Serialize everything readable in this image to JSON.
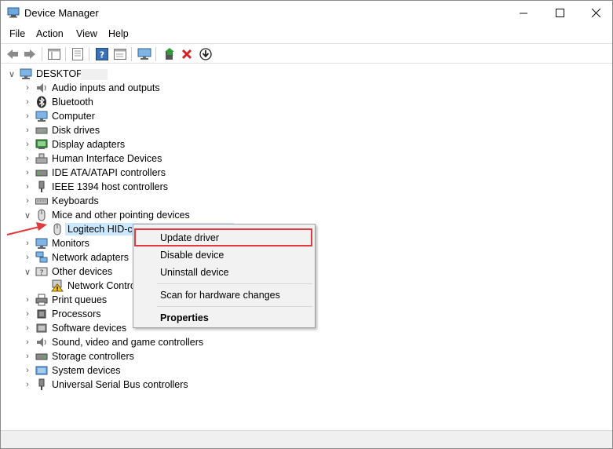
{
  "window": {
    "title": "Device Manager"
  },
  "menu": [
    "File",
    "Action",
    "View",
    "Help"
  ],
  "tree": {
    "root": "DESKTOP",
    "categories": [
      {
        "label": "Audio inputs and outputs",
        "icon": "speaker-icon"
      },
      {
        "label": "Bluetooth",
        "icon": "bluetooth-icon"
      },
      {
        "label": "Computer",
        "icon": "computer-icon"
      },
      {
        "label": "Disk drives",
        "icon": "disk-drive-icon"
      },
      {
        "label": "Display adapters",
        "icon": "display-adapter-icon"
      },
      {
        "label": "Human Interface Devices",
        "icon": "hid-icon"
      },
      {
        "label": "IDE ATA/ATAPI controllers",
        "icon": "ide-controller-icon"
      },
      {
        "label": "IEEE 1394 host controllers",
        "icon": "ieee1394-icon"
      },
      {
        "label": "Keyboards",
        "icon": "keyboard-icon"
      },
      {
        "label": "Mice and other pointing devices",
        "icon": "mouse-icon",
        "expanded": true
      },
      {
        "label": "Monitors",
        "icon": "monitor-icon"
      },
      {
        "label": "Network adapters",
        "icon": "network-icon"
      },
      {
        "label": "Other devices",
        "icon": "other-devices-icon",
        "expanded": true
      },
      {
        "label": "Print queues",
        "icon": "printer-icon"
      },
      {
        "label": "Processors",
        "icon": "processor-icon"
      },
      {
        "label": "Software devices",
        "icon": "software-device-icon"
      },
      {
        "label": "Sound, video and game controllers",
        "icon": "sound-icon"
      },
      {
        "label": "Storage controllers",
        "icon": "storage-icon"
      },
      {
        "label": "System devices",
        "icon": "system-device-icon"
      },
      {
        "label": "Universal Serial Bus controllers",
        "icon": "usb-icon"
      }
    ],
    "mouse_child": "Logitech HID-co",
    "other_child": "Network Contro"
  },
  "context_menu": {
    "update_driver": "Update driver",
    "disable_device": "Disable device",
    "uninstall_device": "Uninstall device",
    "scan_changes": "Scan for hardware changes",
    "properties": "Properties"
  },
  "colors": {
    "highlight_box": "#e0393e",
    "selection": "#cce8ff",
    "arrow": "#e0393e"
  }
}
